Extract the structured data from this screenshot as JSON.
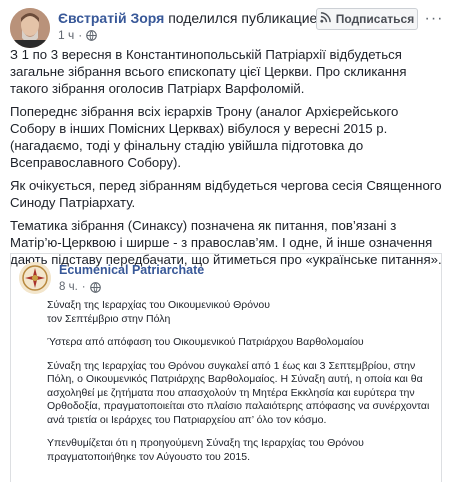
{
  "post": {
    "author": "Євстратій Зоря",
    "action": "поделился публикацией.",
    "time": "1 ч",
    "dot": "·",
    "subscribe_label": "Подписаться",
    "more_label": "···",
    "paragraphs": [
      "З 1 по 3 вересня в Константинопольській Патріархії відбудеться загальне зібрання всього єпископату цієї Церкви. Про скликання такого зібрання оголосив Патріарх Варфоломій.",
      "Попереднє зібрання всіх ієрархів Трону (аналог Архієрейського Собору в інших Помісних Церквах) вібулося у вересні 2015 р. (нагадаємо, тоді у фінальну стадію увійшла підготовка до Всеправославного Собору).",
      "Як очікується, перед зібранням відбудеться чергова сесія Священного Синоду Патріархату.",
      "Тематика зібрання (Синаксу) позначена як питання, пов’язані з Матір’ю-Церквою і ширше - з православ’ям. І одне, й інше означення дають підставу передбачати, що йтиметься про «українське питання»."
    ]
  },
  "shared": {
    "page_name": "Ecumenical Patriarchate",
    "time": "8 ч.",
    "dot": "·",
    "paragraphs": [
      "Σύναξη της Ιεραρχίας του Οικουμενικού Θρόνου\nτον Σεπτέμβριο στην Πόλη",
      "Ύστερα από απόφαση του Οικουμενικού Πατριάρχου Βαρθολομαίου",
      "Σύναξη της Ιεραρχίας του Θρόνου συγκαλεί από 1 έως και 3 Σεπτεμβρίου, στην Πόλη, ο Οικουμενικός Πατριάρχης Βαρθολομαίος. Η Σύναξη αυτή, η οποία και θα ασχοληθεί με ζητήματα που απασχολούν τη Μητέρα Εκκλησία και ευρύτερα την Ορθοδοξία, πραγματοποιείται στο πλαίσιο παλαιότερης απόφασης να συνέρχονται ανά τριετία οι Ιεράρχες του Πατριαρχείου απ’ όλο τον κόσμο.",
      "Υπενθυμίζεται ότι η προηγούμενη Σύναξη της Ιεραρχίας του Θρόνου πραγματοποιήθηκε τον Αύγουστο του 2015."
    ]
  }
}
